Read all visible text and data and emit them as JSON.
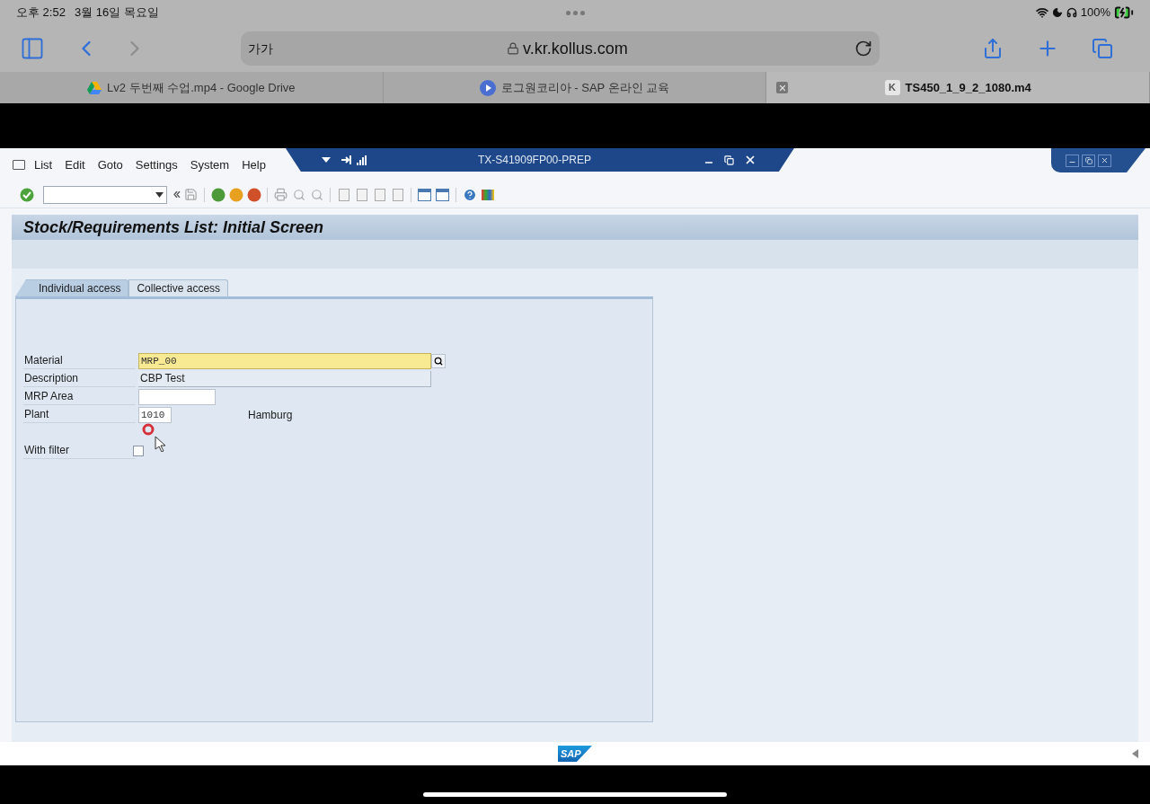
{
  "status_bar": {
    "time": "오후 2:52",
    "date": "3월 16일 목요일",
    "battery": "100%"
  },
  "browser": {
    "address_prefix": "가가",
    "url": "v.kr.kollus.com",
    "tabs": [
      {
        "title": "Lv2 두번째 수업.mp4 - Google Drive",
        "selected": false,
        "kind": "drive"
      },
      {
        "title": "로그원코리아 - SAP 온라인 교육",
        "selected": false,
        "kind": "play"
      },
      {
        "title": "TS450_1_9_2_1080.m4",
        "selected": true,
        "kind": "letter",
        "letter": "K"
      }
    ]
  },
  "sap": {
    "logo_text": "SAP",
    "menu": [
      "List",
      "Edit",
      "Goto",
      "Settings",
      "System",
      "Help"
    ],
    "system_title": "TX-S41909FP00-PREP",
    "screen_title": "Stock/Requirements List: Initial Screen",
    "tabs": [
      {
        "label": "Individual access",
        "selected": true
      },
      {
        "label": "Collective access",
        "selected": false
      }
    ],
    "fields": [
      {
        "kind": "search",
        "label": "Material",
        "value": "MRP_00"
      },
      {
        "kind": "display",
        "label": "Description",
        "value": "CBP Test"
      },
      {
        "kind": "input",
        "label": "MRP Area"
      },
      {
        "kind": "input",
        "label": "Plant",
        "value": "1010",
        "note": "Hamburg"
      },
      {
        "kind": "checkbox",
        "label": "With filter",
        "checked": false
      }
    ]
  }
}
